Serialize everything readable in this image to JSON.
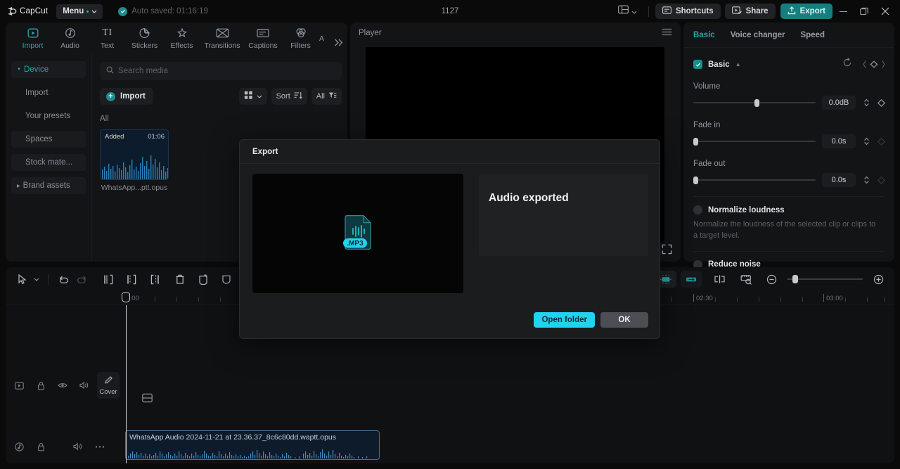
{
  "titlebar": {
    "app_name": "CapCut",
    "menu_label": "Menu",
    "autosave_text": "Auto saved: 01:16:19",
    "project_title": "1127",
    "shortcuts_label": "Shortcuts",
    "share_label": "Share",
    "export_label": "Export",
    "icons": [
      "capcut-logo-icon",
      "chevron-down-icon",
      "check-circle-icon",
      "layout-icon",
      "shortcuts-icon",
      "share-icon",
      "export-upload-icon",
      "minimize-icon",
      "maximize-icon",
      "close-icon"
    ]
  },
  "tabs": [
    {
      "label": "Import",
      "icon": "import-icon",
      "active": true
    },
    {
      "label": "Audio",
      "icon": "audio-icon",
      "active": false
    },
    {
      "label": "Text",
      "icon": "text-icon",
      "active": false
    },
    {
      "label": "Stickers",
      "icon": "stickers-icon",
      "active": false
    },
    {
      "label": "Effects",
      "icon": "effects-icon",
      "active": false
    },
    {
      "label": "Transitions",
      "icon": "transitions-icon",
      "active": false
    },
    {
      "label": "Captions",
      "icon": "captions-icon",
      "active": false
    },
    {
      "label": "Filters",
      "icon": "filters-icon",
      "active": false
    },
    {
      "label": "A",
      "icon": "truncated-icon",
      "active": false
    }
  ],
  "sidebar": {
    "items": [
      {
        "label": "Device",
        "active": true
      },
      {
        "label": "Import",
        "active": false
      },
      {
        "label": "Your presets",
        "active": false
      },
      {
        "label": "Spaces",
        "active": false
      },
      {
        "label": "Stock mate...",
        "active": false
      },
      {
        "label": "Brand assets",
        "active": false
      }
    ]
  },
  "media": {
    "search_placeholder": "Search media",
    "import_label": "Import",
    "sort_label": "Sort",
    "filter_label": "All",
    "group_label": "All",
    "items": [
      {
        "badge": "Added",
        "duration": "01:06",
        "name": "WhatsApp...ptt.opus"
      }
    ]
  },
  "player": {
    "title": "Player"
  },
  "inspector": {
    "tabs": [
      {
        "label": "Basic",
        "active": true
      },
      {
        "label": "Voice changer",
        "active": false
      },
      {
        "label": "Speed",
        "active": false
      }
    ],
    "section_title": "Basic",
    "volume_label": "Volume",
    "volume_value": "0.0dB",
    "fade_in_label": "Fade in",
    "fade_in_value": "0.0s",
    "fade_out_label": "Fade out",
    "fade_out_value": "0.0s",
    "normalize_label": "Normalize loudness",
    "normalize_desc": "Normalize the loudness of the selected clip or clips to a target level.",
    "reduce_noise_label": "Reduce noise"
  },
  "timeline": {
    "ruler_labels": [
      "00:00",
      "02:30",
      "03:00"
    ],
    "playhead_time": "00:00",
    "cover_label": "Cover",
    "clip_name": "WhatsApp Audio 2024-11-21 at 23.36.37_8c6c80dd.waptt.opus",
    "tool_icons": [
      "select-cursor-icon",
      "chevron-down-icon",
      "undo-icon",
      "redo-icon",
      "split-icon",
      "trim-left-icon",
      "trim-right-icon",
      "delete-icon",
      "crop-icon",
      "mask-icon"
    ],
    "right_tool_icons": [
      "audio-stretch-icon",
      "auto-beat-icon",
      "mirror-icon",
      "split-clip-icon",
      "snap-icon",
      "zoom-out-icon",
      "zoom-slider",
      "zoom-in-icon"
    ],
    "track_icons": [
      "video-track-icon",
      "lock-icon",
      "eye-icon",
      "volume-icon",
      "more-icon",
      "music-note-icon"
    ]
  },
  "dialog": {
    "title": "Export",
    "heading": "Audio exported",
    "file_badge": ".MP3",
    "open_folder_label": "Open folder",
    "ok_label": "OK"
  },
  "colors": {
    "accent_teal": "#2ba8a8",
    "export_btn": "#157f7f",
    "primary_cyan": "#22d3ee",
    "clip_border": "#4a6e98",
    "panel_bg": "#131416"
  }
}
